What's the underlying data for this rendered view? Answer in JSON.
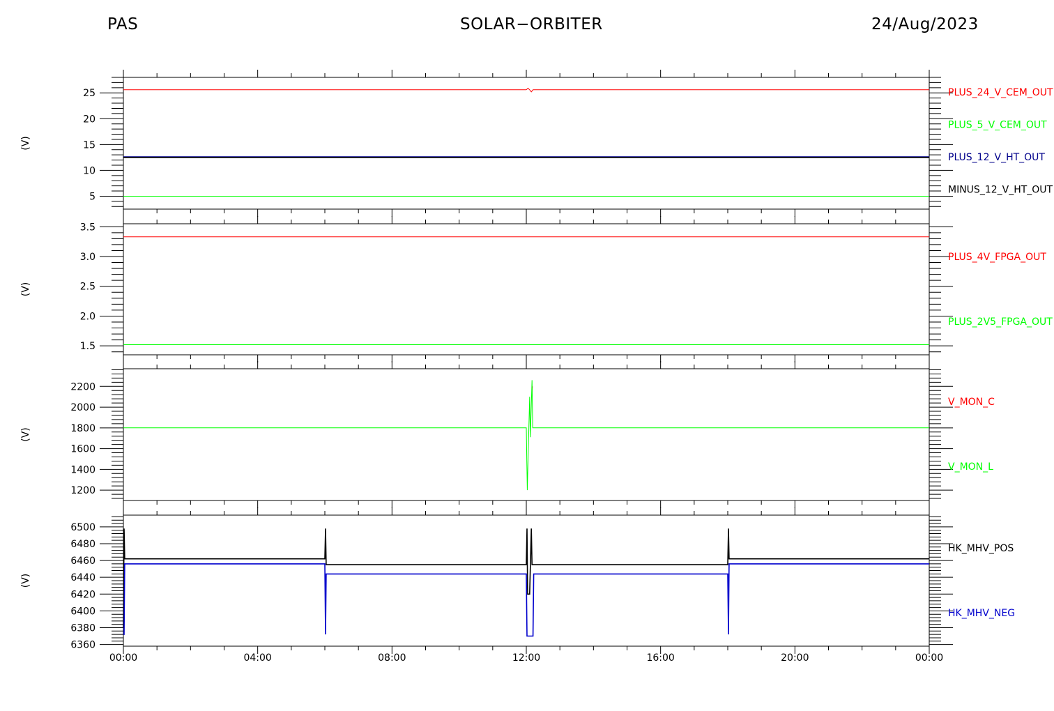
{
  "header": {
    "left": "PAS",
    "center": "SOLAR−ORBITER",
    "right": "24/Aug/2023"
  },
  "colors": {
    "red": "#ff0000",
    "green": "#00ff00",
    "blue": "#00008b",
    "black": "#000000"
  },
  "chart_data": [
    {
      "type": "line",
      "ylabel": "(V)",
      "ylim": [
        2.5,
        28.0
      ],
      "yticks": [
        5,
        10,
        15,
        20,
        25
      ],
      "xlim": [
        "00:00",
        "24:00"
      ],
      "xticks": [
        "00:00",
        "04:00",
        "08:00",
        "12:00",
        "16:00",
        "20:00",
        "00:00"
      ],
      "series": [
        {
          "name": "PLUS_24_V_CEM_OUT",
          "color": "#ff0000",
          "x": [
            0,
            12.0,
            12.05,
            12.1,
            12.15,
            12.2,
            24
          ],
          "y": [
            25.6,
            25.6,
            25.9,
            25.6,
            25.2,
            25.6,
            25.6
          ]
        },
        {
          "name": "PLUS_5_V_CEM_OUT",
          "color": "#00ff00",
          "x": [
            0,
            24
          ],
          "y": [
            5.0,
            5.0
          ]
        },
        {
          "name": "PLUS_12_V_HT_OUT",
          "color": "#00008b",
          "x": [
            0,
            24
          ],
          "y": [
            12.6,
            12.6
          ]
        },
        {
          "name": "MINUS_12_V_HT_OUT",
          "color": "#000000",
          "x": [
            0,
            24
          ],
          "y": [
            12.5,
            12.5
          ]
        }
      ]
    },
    {
      "type": "line",
      "ylabel": "(V)",
      "ylim": [
        1.35,
        3.55
      ],
      "yticks": [
        1.5,
        2.0,
        2.5,
        3.0,
        3.5
      ],
      "xlim": [
        "00:00",
        "24:00"
      ],
      "xticks": [
        "00:00",
        "04:00",
        "08:00",
        "12:00",
        "16:00",
        "20:00",
        "00:00"
      ],
      "series": [
        {
          "name": "PLUS_4V_FPGA_OUT",
          "color": "#ff0000",
          "x": [
            0,
            24
          ],
          "y": [
            3.33,
            3.33
          ]
        },
        {
          "name": "PLUS_2V5_FPGA_OUT",
          "color": "#00ff00",
          "x": [
            0,
            24
          ],
          "y": [
            1.52,
            1.52
          ]
        }
      ]
    },
    {
      "type": "line",
      "ylabel": "(V)",
      "ylim": [
        1100,
        2370
      ],
      "yticks": [
        1200,
        1400,
        1600,
        1800,
        2000,
        2200
      ],
      "xlim": [
        "00:00",
        "24:00"
      ],
      "xticks": [
        "00:00",
        "04:00",
        "08:00",
        "12:00",
        "16:00",
        "20:00",
        "00:00"
      ],
      "series": [
        {
          "name": "V_MON_C",
          "color": "#ff0000",
          "x": [
            12.17,
            12.18
          ],
          "y": [
            2150,
            2200
          ]
        },
        {
          "name": "V_MON_L",
          "color": "#00ff00",
          "x": [
            0,
            12.0,
            12.03,
            12.1,
            12.12,
            12.17,
            12.19,
            12.22,
            24
          ],
          "y": [
            1800,
            1800,
            1200,
            2100,
            1710,
            2260,
            1800,
            1800,
            1800
          ]
        }
      ]
    },
    {
      "type": "line",
      "ylabel": "(V)",
      "ylim": [
        6358,
        6514
      ],
      "yticks": [
        6360,
        6380,
        6400,
        6420,
        6440,
        6460,
        6480,
        6500
      ],
      "xlim": [
        "00:00",
        "24:00"
      ],
      "xticks": [
        "00:00",
        "04:00",
        "08:00",
        "12:00",
        "16:00",
        "20:00",
        "00:00"
      ],
      "series": [
        {
          "name": "HK_MHV_POS",
          "color": "#000000",
          "x": [
            0,
            0.02,
            0.04,
            0.1,
            6.0,
            6.02,
            6.04,
            6.1,
            12.0,
            12.02,
            12.04,
            12.1,
            12.15,
            12.17,
            12.2,
            18.0,
            18.02,
            18.04,
            18.1,
            24
          ],
          "y": [
            6380,
            6498,
            6462,
            6462,
            6462,
            6498,
            6455,
            6455,
            6455,
            6498,
            6420,
            6420,
            6498,
            6455,
            6455,
            6455,
            6498,
            6462,
            6462,
            6462
          ]
        },
        {
          "name": "HK_MHV_NEG",
          "color": "#0000cd",
          "x": [
            0,
            0.02,
            0.04,
            6.0,
            6.02,
            6.04,
            6.08,
            12.0,
            12.02,
            12.2,
            12.22,
            12.25,
            18.0,
            18.02,
            18.04,
            24
          ],
          "y": [
            6372,
            6372,
            6456,
            6456,
            6372,
            6444,
            6444,
            6444,
            6370,
            6370,
            6444,
            6444,
            6444,
            6372,
            6456,
            6456
          ]
        }
      ]
    }
  ]
}
